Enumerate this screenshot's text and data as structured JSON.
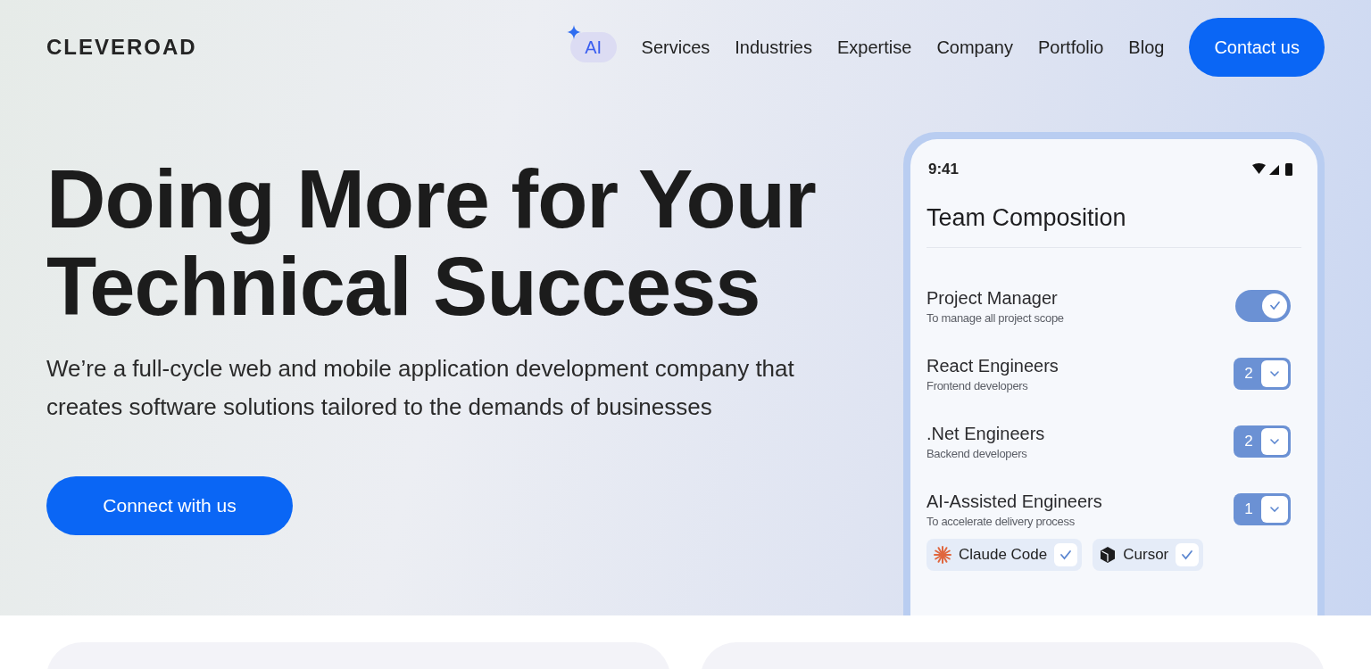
{
  "logo": "CLEVEROAD",
  "nav": {
    "ai_badge": "AI",
    "items": [
      "Services",
      "Industries",
      "Expertise",
      "Company",
      "Portfolio",
      "Blog"
    ],
    "cta": "Contact us"
  },
  "hero": {
    "title_lines": [
      "Doing More for Your",
      "Technical Success"
    ],
    "subtitle": "We’re a full-cycle web and mobile application development company that creates software solutions tailored to the demands of businesses",
    "cta": "Connect with us"
  },
  "phone": {
    "time": "9:41",
    "title": "Team Composition",
    "rows": [
      {
        "kind": "toggle",
        "name": "Project Manager",
        "description": "To manage all project scope",
        "on": true
      },
      {
        "kind": "select",
        "name": "React Engineers",
        "description": "Frontend developers",
        "value": "2"
      },
      {
        "kind": "select",
        "name": ".Net Engineers",
        "description": "Backend developers",
        "value": "2"
      },
      {
        "kind": "select",
        "name": "AI-Assisted Engineers",
        "description": "To accelerate delivery process",
        "value": "1"
      }
    ],
    "tools": [
      {
        "kind": "burst",
        "label": "Claude Code",
        "checked": true
      },
      {
        "kind": "cube",
        "label": "Cursor",
        "checked": true
      }
    ]
  }
}
